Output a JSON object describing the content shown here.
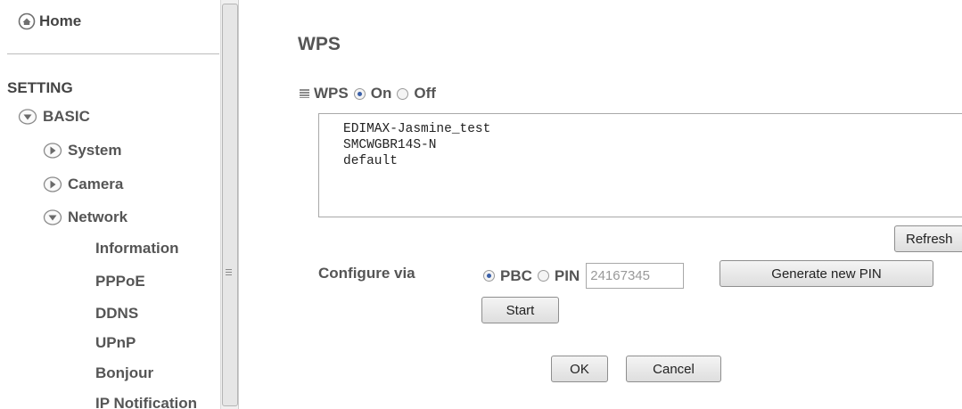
{
  "sidebar": {
    "home_label": "Home",
    "section_title": "SETTING",
    "basic_label": "BASIC",
    "system_label": "System",
    "camera_label": "Camera",
    "network_label": "Network",
    "network_items": [
      "Information",
      "PPPoE",
      "DDNS",
      "UPnP",
      "Bonjour",
      "IP Notification"
    ]
  },
  "page": {
    "title": "WPS"
  },
  "wps": {
    "label": "WPS",
    "on_label": "On",
    "off_label": "Off",
    "selected": "On"
  },
  "ssid_list": [
    "EDIMAX-Jasmine_test",
    "SMCWGBR14S-N",
    "default"
  ],
  "buttons": {
    "refresh": "Refresh",
    "generate_pin": "Generate new PIN",
    "start": "Start",
    "ok": "OK",
    "cancel": "Cancel"
  },
  "configure": {
    "label": "Configure via",
    "pbc_label": "PBC",
    "pin_label": "PIN",
    "pin_value": "24167345",
    "selected": "PBC"
  },
  "colors": {
    "text_gray": "#555555",
    "radio_dot": "#3a5fa8",
    "bullet_icon": "#7a7a7a"
  }
}
